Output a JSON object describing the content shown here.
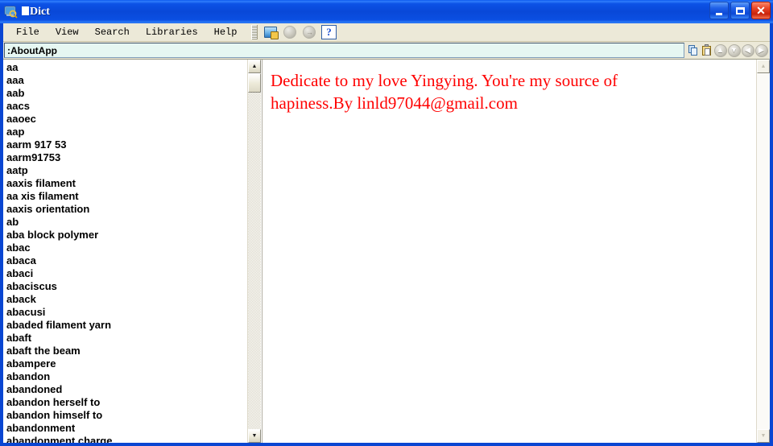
{
  "window": {
    "title": "█Dict",
    "title_icon": "dictionary-app-icon",
    "buttons": {
      "minimize": "–",
      "maximize": "□",
      "close": "✕"
    }
  },
  "menubar": {
    "items": [
      {
        "label": "File",
        "name": "menu-file"
      },
      {
        "label": "View",
        "name": "menu-view"
      },
      {
        "label": "Search",
        "name": "menu-search"
      },
      {
        "label": "Libraries",
        "name": "menu-libraries"
      },
      {
        "label": "Help",
        "name": "menu-help"
      }
    ],
    "toolbar": {
      "monitor_icon": "monitor-icon",
      "disabled_1": "●",
      "disabled_2": "→",
      "help_label": "?"
    }
  },
  "address": {
    "value": ":AboutApp",
    "placeholder": "",
    "buttons": {
      "copy": "copy-icon",
      "paste": "paste-icon",
      "up": "▲",
      "down": "▼",
      "back": "◀",
      "forward": "▶"
    }
  },
  "wordlist": {
    "items": [
      "aa",
      "aaa",
      "aab",
      "aacs",
      "aaoec",
      "aap",
      "aarm 917 53",
      "aarm91753",
      "aatp",
      "aaxis filament",
      "aa xis filament",
      "aaxis orientation",
      "ab",
      "aba block polymer",
      "abac",
      "abaca",
      "abaci",
      "abaciscus",
      "aback",
      "abacusi",
      "abaded filament yarn",
      "abaft",
      "abaft the beam",
      "abampere",
      "abandon",
      "abandoned",
      "abandon herself to",
      "abandon himself to",
      "abandonment",
      "abandonment charge"
    ],
    "scrollbar": {
      "up": "▲",
      "down": "▼"
    }
  },
  "content": {
    "text": "Dedicate to my love Yingying. You're my source of hapiness.By linld97044@gmail.com",
    "color": "#ff0000",
    "scrollbar": {
      "up": "▲",
      "down": "▼"
    }
  },
  "colors": {
    "titlebar_blue": "#0a46d2",
    "menubar_beige": "#ece9d8",
    "address_field": "#e6f7f2",
    "content_red": "#ff0000"
  }
}
